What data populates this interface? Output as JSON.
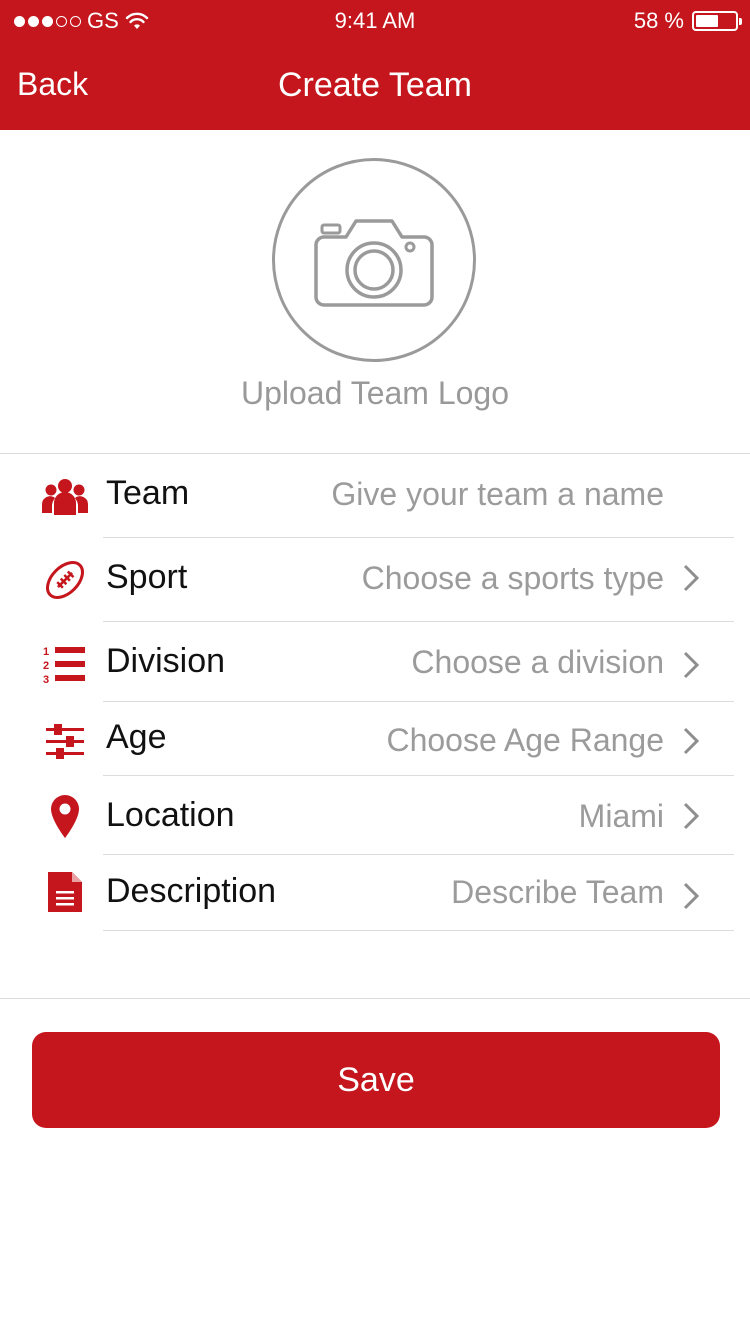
{
  "status_bar": {
    "carrier": "GS",
    "time": "9:41 AM",
    "battery": "58 %",
    "battery_level": 0.58,
    "signal_dots_filled": 3,
    "signal_dots_total": 5
  },
  "header": {
    "back_label": "Back",
    "title": "Create Team"
  },
  "logo": {
    "upload_label": "Upload Team Logo",
    "icon": "camera-icon"
  },
  "form": {
    "rows": [
      {
        "icon": "team-icon",
        "label": "Team",
        "value": "Give your team a name",
        "has_arrow": false
      },
      {
        "icon": "football-icon",
        "label": "Sport",
        "value": "Choose a sports type",
        "has_arrow": true
      },
      {
        "icon": "numbered-list-icon",
        "label": "Division",
        "value": "Choose a division",
        "has_arrow": true
      },
      {
        "icon": "sliders-icon",
        "label": "Age",
        "value": "Choose Age Range",
        "has_arrow": true
      },
      {
        "icon": "location-pin-icon",
        "label": "Location",
        "value": "Miami",
        "has_arrow": true
      },
      {
        "icon": "document-icon",
        "label": "Description",
        "value": "Describe Team",
        "has_arrow": true
      }
    ]
  },
  "actions": {
    "save_label": "Save"
  },
  "colors": {
    "accent": "#c4161c",
    "placeholder": "#9b9b9b",
    "separator": "#dcdcdc"
  }
}
